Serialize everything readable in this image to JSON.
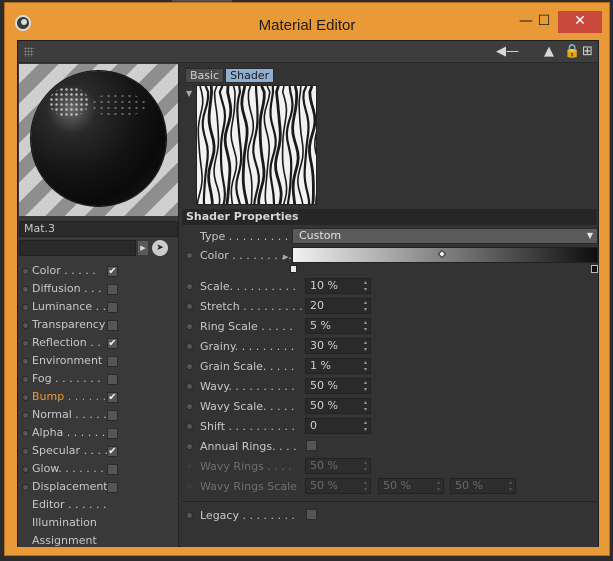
{
  "window": {
    "title": "Material Editor",
    "min_glyph": "—",
    "max_glyph": "☐",
    "close_glyph": "✕"
  },
  "toolbar": {
    "icons": [
      "back-arrow-icon",
      "arrow-up-icon",
      "lock-icon",
      "new-window-icon"
    ]
  },
  "left": {
    "material_name": "Mat.3",
    "channels": [
      {
        "label": "Color . . . . .",
        "checkbox": true,
        "checked": true,
        "active": false
      },
      {
        "label": "Diffusion . . .",
        "checkbox": true,
        "checked": false,
        "active": false
      },
      {
        "label": "Luminance . .",
        "checkbox": true,
        "checked": false,
        "active": false
      },
      {
        "label": "Transparency",
        "checkbox": true,
        "checked": false,
        "active": false
      },
      {
        "label": "Reflection . .",
        "checkbox": true,
        "checked": true,
        "active": false
      },
      {
        "label": "Environment",
        "checkbox": true,
        "checked": false,
        "active": false
      },
      {
        "label": "Fog . . . . . . .",
        "checkbox": true,
        "checked": false,
        "active": false
      },
      {
        "label": "Bump . . . . . .",
        "checkbox": true,
        "checked": true,
        "active": true
      },
      {
        "label": "Normal . . . . .",
        "checkbox": true,
        "checked": false,
        "active": false
      },
      {
        "label": "Alpha . . . . . .",
        "checkbox": true,
        "checked": false,
        "active": false
      },
      {
        "label": "Specular . . . .",
        "checkbox": true,
        "checked": true,
        "active": false
      },
      {
        "label": "Glow. . . . . . .",
        "checkbox": true,
        "checked": false,
        "active": false
      },
      {
        "label": "Displacement",
        "checkbox": true,
        "checked": false,
        "active": false
      },
      {
        "label": "Editor . . . . . .",
        "checkbox": false,
        "checked": false,
        "active": false
      },
      {
        "label": "Illumination",
        "checkbox": false,
        "checked": false,
        "active": false
      },
      {
        "label": "Assignment",
        "checkbox": false,
        "checked": false,
        "active": false
      }
    ]
  },
  "right": {
    "tabs": [
      {
        "label": "Basic",
        "active": false
      },
      {
        "label": "Shader",
        "active": true
      }
    ],
    "section_title": "Shader Properties",
    "type_label": "Type . . . . . . . . . .",
    "type_value": "Custom",
    "color_label": "Color . . . . . . . . .",
    "params": [
      {
        "label": "Scale. . . . . . . . . .",
        "value": "10 %"
      },
      {
        "label": "Stretch . . . . . . . . .",
        "value": "20"
      },
      {
        "label": "Ring Scale . . . . .",
        "value": "5 %"
      },
      {
        "label": "Grainy. . . . . . . . .",
        "value": "30 %"
      },
      {
        "label": "Grain Scale. . . . .",
        "value": "1 %"
      },
      {
        "label": "Wavy. . . . . . . . . .",
        "value": "50 %"
      },
      {
        "label": "Wavy Scale. . . . .",
        "value": "50 %"
      },
      {
        "label": "Shift . . . . . . . . . .",
        "value": "0"
      }
    ],
    "annual_rings_label": "Annual Rings. . . .",
    "wavy_rings_label": "Wavy Rings . . . .",
    "wavy_rings_value": "50 %",
    "wavy_rings_scale_label": "Wavy Rings Scale",
    "wavy_rings_scale_values": [
      "50 %",
      "50 %",
      "50 %"
    ],
    "legacy_label": "Legacy . . . . . . . ."
  }
}
